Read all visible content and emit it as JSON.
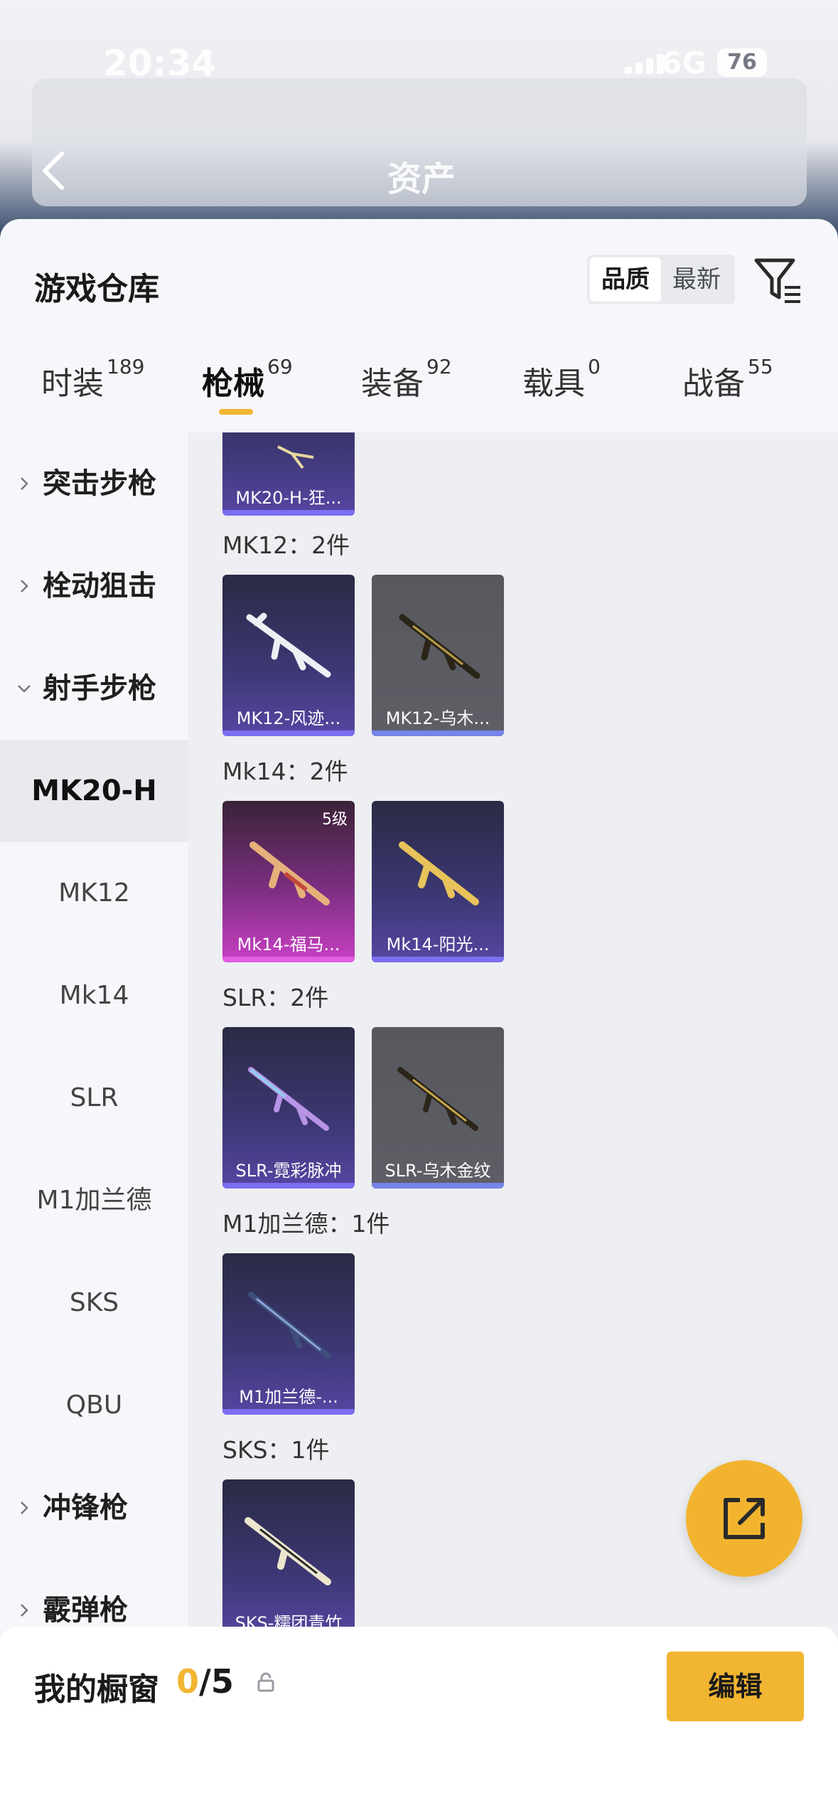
{
  "status": {
    "time": "20:34",
    "network": "6G",
    "battery": "76"
  },
  "nav": {
    "title": "资产"
  },
  "warehouse": {
    "title": "游戏仓库",
    "sort_options": [
      {
        "label": "品质",
        "selected": true
      },
      {
        "label": "最新",
        "selected": false
      }
    ]
  },
  "tabs": [
    {
      "label": "时装",
      "count": "189"
    },
    {
      "label": "枪械",
      "count": "69",
      "active": true
    },
    {
      "label": "装备",
      "count": "92"
    },
    {
      "label": "载具",
      "count": "0"
    },
    {
      "label": "战备",
      "count": "55"
    }
  ],
  "sidebar": {
    "items": [
      {
        "label": "突击步枪",
        "type": "category",
        "expanded": false
      },
      {
        "label": "栓动狙击",
        "type": "category",
        "expanded": false
      },
      {
        "label": "射手步枪",
        "type": "category",
        "expanded": true
      },
      {
        "label": "MK20-H",
        "type": "sub",
        "selected": true
      },
      {
        "label": "MK12",
        "type": "sub"
      },
      {
        "label": "Mk14",
        "type": "sub"
      },
      {
        "label": "SLR",
        "type": "sub"
      },
      {
        "label": "M1加兰德",
        "type": "sub"
      },
      {
        "label": "SKS",
        "type": "sub"
      },
      {
        "label": "QBU",
        "type": "sub"
      },
      {
        "label": "冲锋枪",
        "type": "category",
        "expanded": false
      },
      {
        "label": "霰弹枪",
        "type": "category",
        "expanded": false
      }
    ]
  },
  "groups": {
    "mk20h": {
      "items": [
        {
          "name": "MK20-H-狂...",
          "rarity": "purple"
        }
      ]
    },
    "mk12": {
      "label": "MK12：2件",
      "items": [
        {
          "name": "MK12-风迹...",
          "rarity": "purple"
        },
        {
          "name": "MK12-乌木...",
          "rarity": "gray"
        }
      ]
    },
    "mk14": {
      "label": "Mk14：2件",
      "items": [
        {
          "name": "Mk14-福马...",
          "rarity": "pink",
          "level": "5级"
        },
        {
          "name": "Mk14-阳光...",
          "rarity": "purple"
        }
      ]
    },
    "slr": {
      "label": "SLR：2件",
      "items": [
        {
          "name": "SLR-霓彩脉冲",
          "rarity": "purple"
        },
        {
          "name": "SLR-乌木金纹",
          "rarity": "gray"
        }
      ]
    },
    "m1": {
      "label": "M1加兰德：1件",
      "items": [
        {
          "name": "M1加兰德-...",
          "rarity": "purple"
        }
      ]
    },
    "sks": {
      "label": "SKS：1件",
      "items": [
        {
          "name": "SKS-糯团青竹",
          "rarity": "purple"
        }
      ]
    }
  },
  "showcase": {
    "label": "我的橱窗",
    "current": "0",
    "total": "/5",
    "edit_label": "编辑"
  },
  "colors": {
    "accent": "#f1b531",
    "purple": "#5646a3",
    "pink": "#c93fc4",
    "gray": "#5e5f66"
  }
}
